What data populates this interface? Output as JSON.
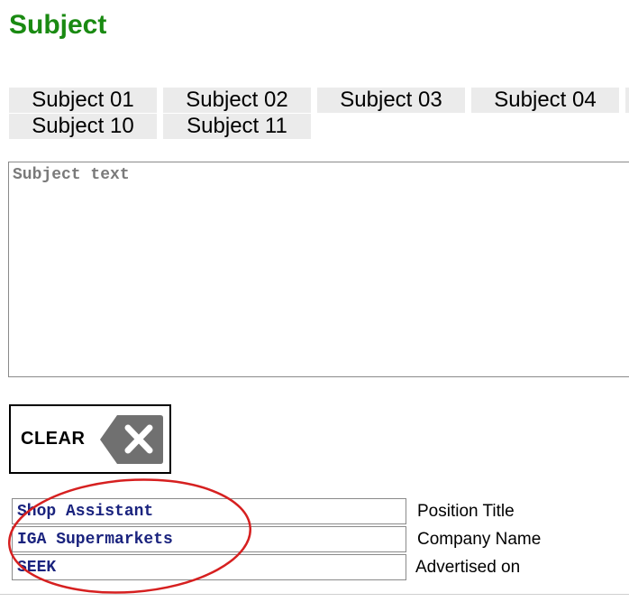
{
  "page": {
    "title": "Subject"
  },
  "subject_tabs": {
    "row1": [
      "Subject 01",
      "Subject 02",
      "Subject 03",
      "Subject 04"
    ],
    "row2": [
      "Subject 10",
      "Subject 11"
    ]
  },
  "subject_text": {
    "placeholder": "Subject text",
    "value": ""
  },
  "clear_button": {
    "label": "CLEAR",
    "icon": "backspace-icon"
  },
  "fields": {
    "position_title": {
      "value": "Shop Assistant",
      "label": "Position Title"
    },
    "company_name": {
      "value": "IGA Supermarkets",
      "label": "Company Name"
    },
    "advertised_on": {
      "value": "SEEK",
      "label": "Advertised on"
    }
  },
  "colors": {
    "title": "#1a8a12",
    "tab_bg": "#ebebeb",
    "field_text": "#1a237e",
    "annotation": "#d62020",
    "icon_bg": "#707070"
  }
}
